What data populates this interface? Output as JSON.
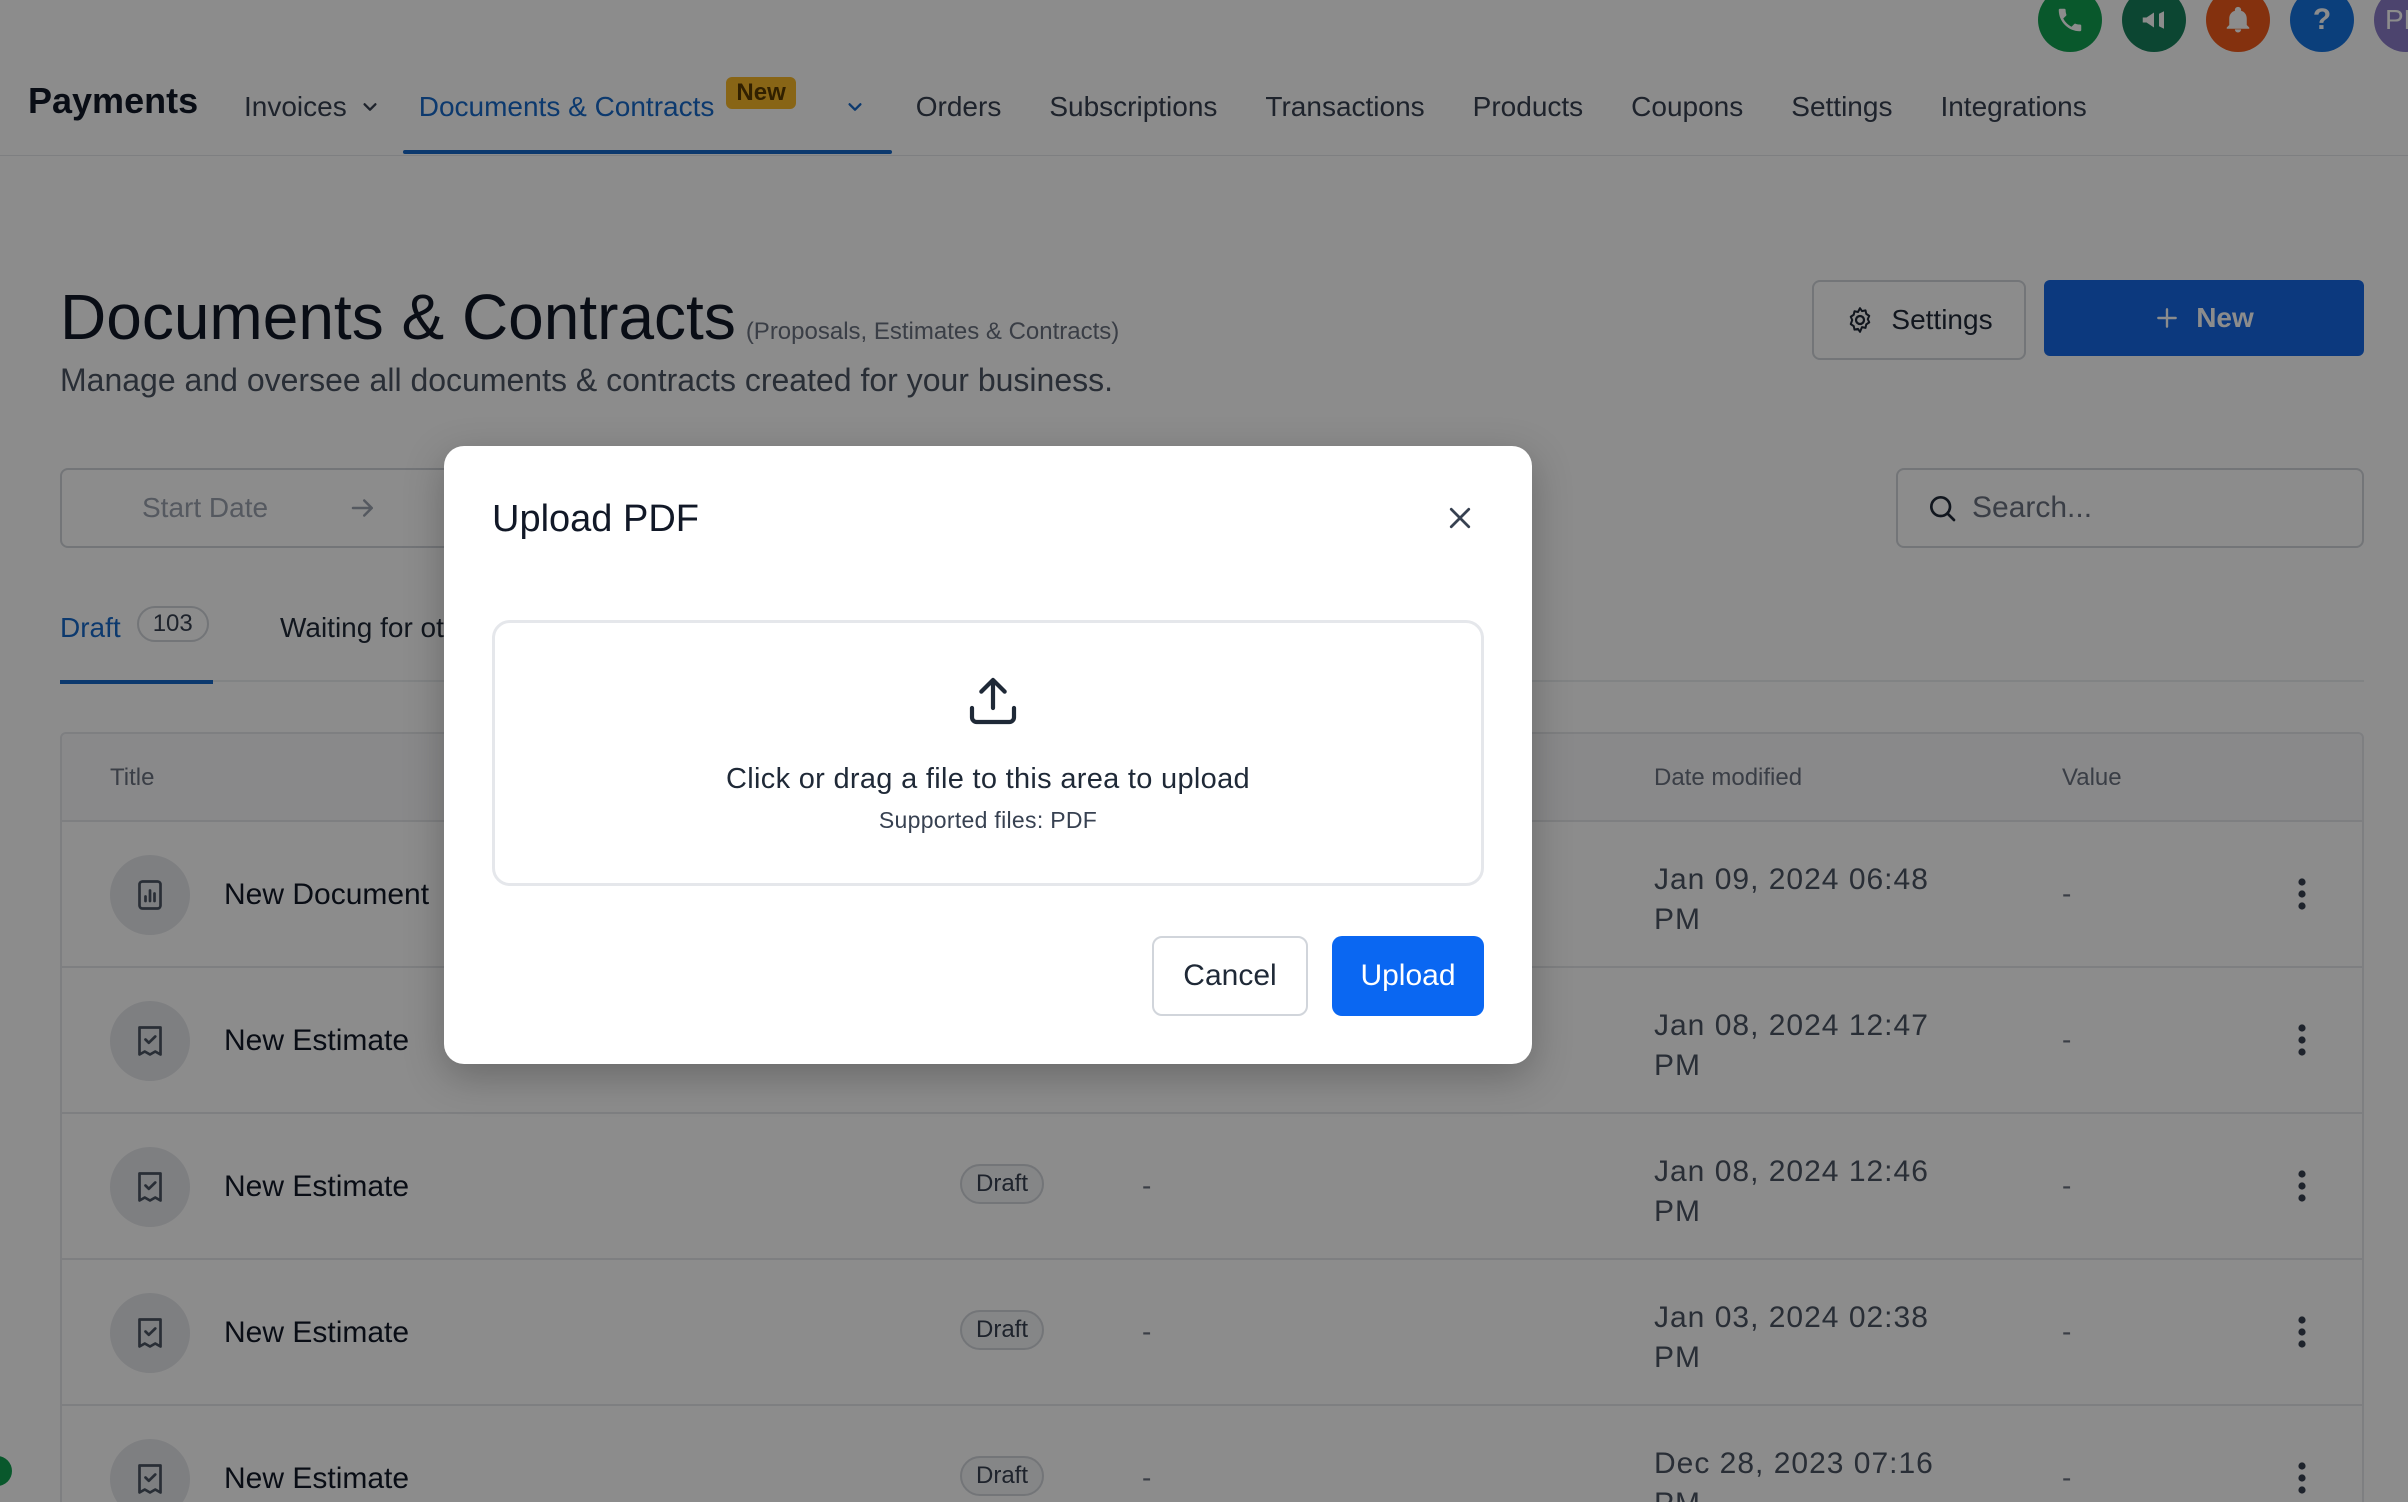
{
  "topbar": {
    "app_title": "Payments",
    "nav": [
      {
        "label": "Invoices",
        "has_dropdown": true
      },
      {
        "label": "Documents & Contracts",
        "badge": "New",
        "has_dropdown": true,
        "active": true
      },
      {
        "label": "Orders"
      },
      {
        "label": "Subscriptions"
      },
      {
        "label": "Transactions"
      },
      {
        "label": "Products"
      },
      {
        "label": "Coupons"
      },
      {
        "label": "Settings"
      },
      {
        "label": "Integrations"
      }
    ],
    "icons": {
      "help_glyph": "?",
      "avatar_initials": "PM"
    }
  },
  "page": {
    "title": "Documents & Contracts",
    "subtitle_small": "(Proposals, Estimates & Contracts)",
    "description": "Manage and oversee all documents & contracts created for your business.",
    "settings_label": "Settings",
    "new_label": "New"
  },
  "filters": {
    "start_date_placeholder": "Start Date",
    "search_placeholder": "Search..."
  },
  "tabs": [
    {
      "label": "Draft",
      "count": "103",
      "active": true
    },
    {
      "label": "Waiting for ot"
    }
  ],
  "table": {
    "columns": {
      "title": "Title",
      "date_modified": "Date modified",
      "value": "Value"
    },
    "rows": [
      {
        "icon": "chart-document-icon",
        "title": "New Document",
        "status": "",
        "recipient": "",
        "date_line1": "Jan 09, 2024 06:48",
        "date_line2": "PM",
        "value": "-"
      },
      {
        "icon": "estimate-icon",
        "title": "New Estimate",
        "status": "",
        "recipient": "",
        "date_line1": "Jan 08, 2024 12:47",
        "date_line2": "PM",
        "value": "-"
      },
      {
        "icon": "estimate-icon",
        "title": "New Estimate",
        "status": "Draft",
        "recipient": "-",
        "date_line1": "Jan 08, 2024 12:46",
        "date_line2": "PM",
        "value": "-"
      },
      {
        "icon": "estimate-icon",
        "title": "New Estimate",
        "status": "Draft",
        "recipient": "-",
        "date_line1": "Jan 03, 2024 02:38",
        "date_line2": "PM",
        "value": "-"
      },
      {
        "icon": "estimate-icon",
        "title": "New Estimate",
        "status": "Draft",
        "recipient": "-",
        "date_line1": "Dec 28, 2023 07:16",
        "date_line2": "PM",
        "value": "-"
      }
    ]
  },
  "modal": {
    "title": "Upload PDF",
    "dropzone_main": "Click or drag a file to this area to upload",
    "dropzone_sub": "Supported files: PDF",
    "cancel_label": "Cancel",
    "upload_label": "Upload"
  },
  "colors": {
    "primary": "#1669e6",
    "upload_button": "#0a67f2",
    "active_nav": "#1669c9",
    "badge": "#f7b928"
  }
}
